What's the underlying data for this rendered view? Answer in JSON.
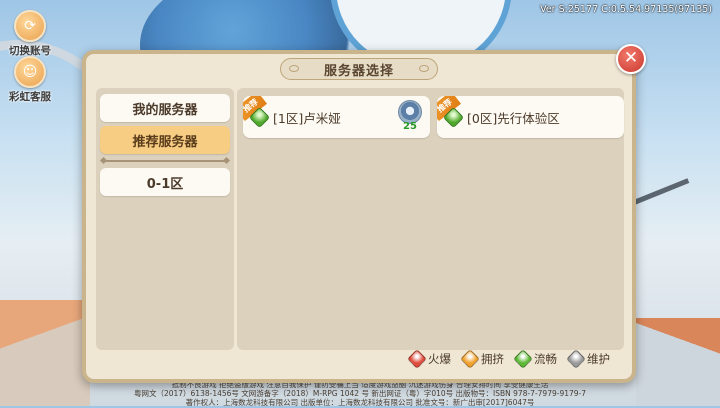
{
  "version": "Ver S:25177 C:0.5.54.97135(97135)",
  "side_buttons": [
    {
      "label": "切换账号",
      "icon": "account-switch-icon"
    },
    {
      "label": "彩虹客服",
      "icon": "customer-service-icon"
    }
  ],
  "dialog": {
    "title": "服务器选择",
    "close_symbol": "✕",
    "categories": [
      {
        "label": "我的服务器",
        "active": false
      },
      {
        "label": "推荐服务器",
        "active": true
      },
      {
        "label": "0-1区",
        "active": false
      }
    ],
    "servers": [
      {
        "badge": "推荐",
        "name": "[1区]卢米娅",
        "status": "流畅",
        "status_color": "#4fa82a",
        "level": "25",
        "has_avatar": true
      },
      {
        "badge": "推荐",
        "name": "[0区]先行体验区",
        "status": "流畅",
        "status_color": "#4fa82a",
        "level": "",
        "has_avatar": false
      }
    ],
    "legend": [
      {
        "label": "火爆",
        "color": "#e04a3a"
      },
      {
        "label": "拥挤",
        "color": "#f0a22c"
      },
      {
        "label": "流畅",
        "color": "#5cb834"
      },
      {
        "label": "维护",
        "color": "#9a9a9a"
      }
    ]
  },
  "footer": {
    "line1": "抵制不良游戏 拒绝盗版游戏 注意自我保护 谨防受骗上当 适度游戏益脑 沉迷游戏伤身 合理安排时间 享受健康生活",
    "line2": "粤网文（2017）6138-1456号 文网游备字（2018）M-RPG 1042 号 新出网证（粤）字010号 出版物号：ISBN 978-7-7979-9179-7",
    "line3": "著作权人：上海数龙科技有限公司 出版单位：上海数龙科技有限公司 批准文号：新广出审[2017]6047号"
  }
}
